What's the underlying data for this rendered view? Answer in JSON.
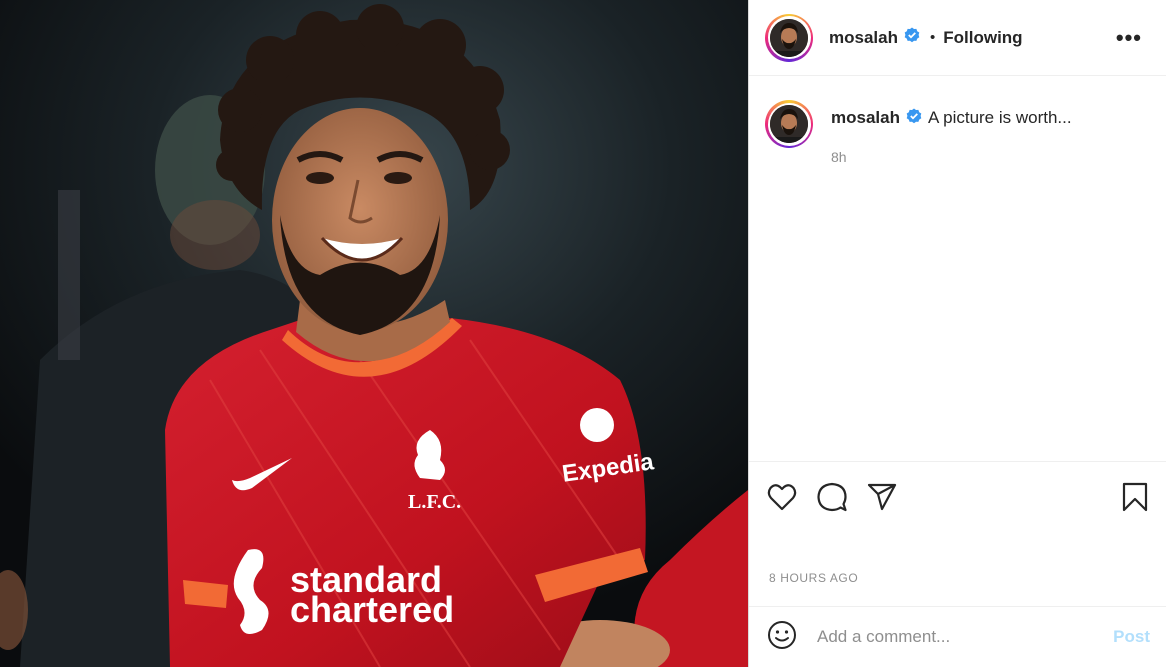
{
  "post": {
    "username": "mosalah",
    "follow_status": "Following",
    "separator": "•",
    "more_label": "•••",
    "caption_text": "A picture is worth...",
    "caption_age": "8h",
    "timestamp": "8 HOURS AGO",
    "photo": {
      "sponsor_line1": "standard",
      "sponsor_line2": "chartered",
      "sleeve_sponsor": "Expedia",
      "crest_text": "L.F.C."
    }
  },
  "comment": {
    "placeholder": "Add a comment...",
    "post_label": "Post"
  },
  "icons": {
    "verified": "verified-badge-icon",
    "like": "heart-icon",
    "comment": "comment-bubble-icon",
    "share": "paper-plane-icon",
    "save": "bookmark-icon",
    "emoji": "smiley-icon",
    "more": "ellipsis-icon"
  },
  "colors": {
    "verified": "#3897f0",
    "post_button_disabled": "#b2dffc",
    "muted_text": "#8e8e8e",
    "jersey_red": "#c8102e",
    "trim_orange": "#f26a35"
  }
}
